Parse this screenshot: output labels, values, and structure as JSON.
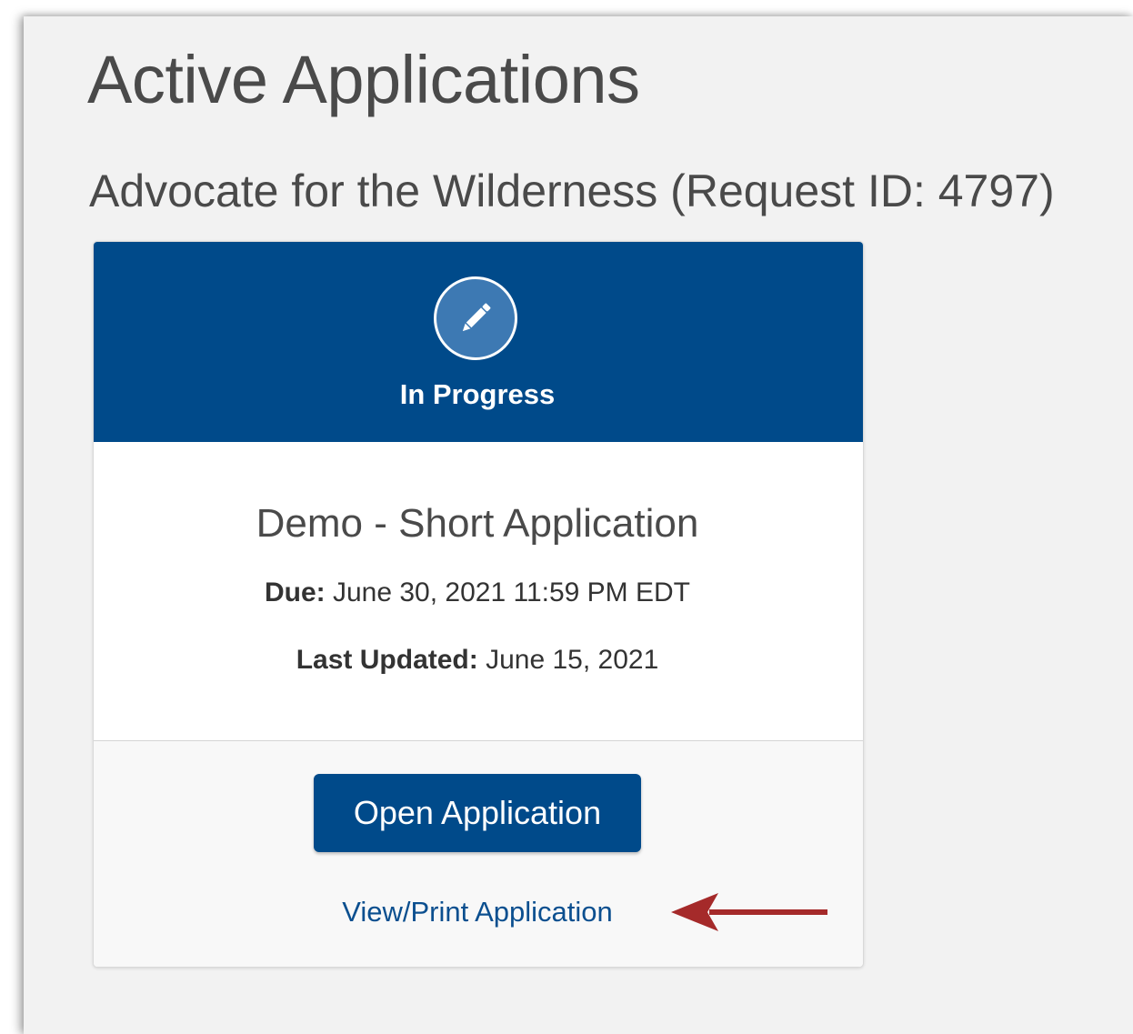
{
  "page": {
    "title": "Active Applications",
    "organization_heading": "Advocate for the Wilderness (Request ID: 4797)"
  },
  "card": {
    "status": {
      "icon": "pencil-icon",
      "label": "In Progress",
      "header_color": "#004a8a"
    },
    "application_name": "Demo - Short Application",
    "due_label": "Due:",
    "due_value": "June 30, 2021 11:59 PM EDT",
    "last_updated_label": "Last Updated:",
    "last_updated_value": "June 15, 2021",
    "open_button_label": "Open Application",
    "view_print_link": "View/Print Application"
  },
  "annotation": {
    "arrow_icon": "left-arrow-icon",
    "arrow_color": "#a52a2a"
  }
}
